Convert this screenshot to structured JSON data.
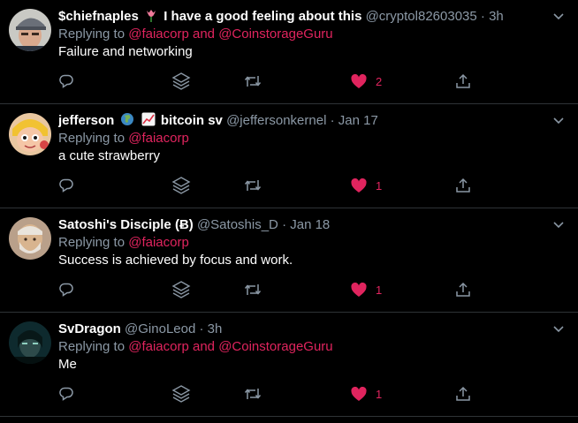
{
  "colors": {
    "background": "#000000",
    "divider": "#2f3336",
    "muted": "#8b98a5",
    "mention": "#e0245e",
    "like": "#e0245e"
  },
  "tweets": [
    {
      "name": "$chiefnaples",
      "name_suffix": "I have a good feeling about this",
      "name_emojis": [
        "tulip-emoji"
      ],
      "handle": "@cryptol82603035",
      "dot": "·",
      "time": "3h",
      "replying_prefix": "Replying to",
      "mention_1": "@faiacorp",
      "and_text": "and",
      "mention_2": "@CoinstorageGuru",
      "text": "Failure and networking",
      "like_count": "2",
      "avatar": "user-avatar-cap"
    },
    {
      "name": "jefferson",
      "name_suffix": "bitcoin sv",
      "name_emojis": [
        "globe-emoji",
        "chart-up-emoji"
      ],
      "handle": "@jeffersonkernel",
      "dot": "·",
      "time": "Jan 17",
      "replying_prefix": "Replying to",
      "mention_1": "@faiacorp",
      "text": "a cute strawberry",
      "like_count": "1",
      "avatar": "user-avatar-cartoon"
    },
    {
      "name": "Satoshi's Disciple (Ƀ)",
      "handle": "@Satoshis_D",
      "dot": "·",
      "time": "Jan 18",
      "replying_prefix": "Replying to",
      "mention_1": "@faiacorp",
      "text": "Success is achieved by focus and work.",
      "like_count": "1",
      "avatar": "user-avatar-bearded"
    },
    {
      "name": "SvDragon",
      "handle": "@GinoLeod",
      "dot": "·",
      "time": "3h",
      "replying_prefix": "Replying to",
      "mention_1": "@faiacorp",
      "and_text": "and",
      "mention_2": "@CoinstorageGuru",
      "text": "Me",
      "like_count": "1",
      "avatar": "user-avatar-dark"
    }
  ]
}
